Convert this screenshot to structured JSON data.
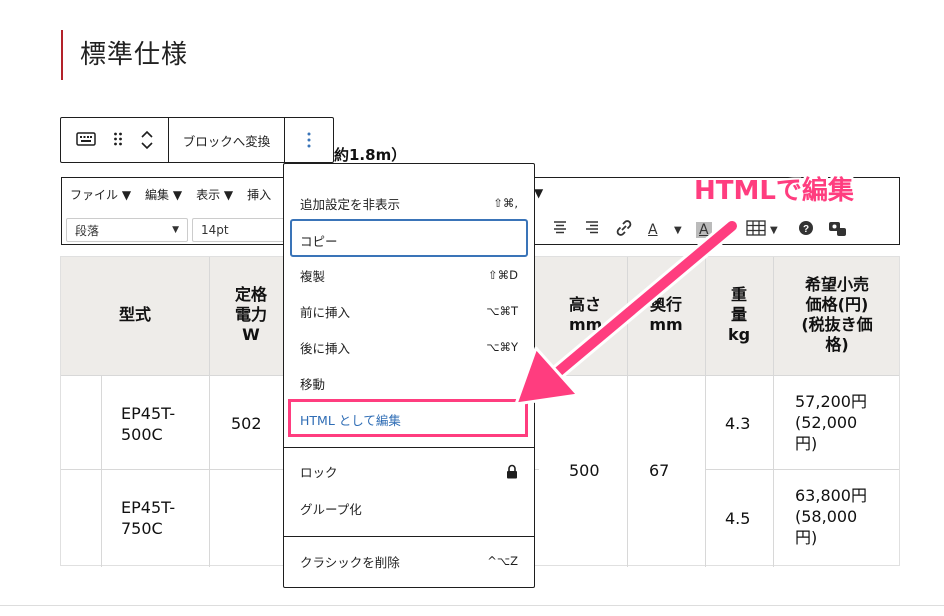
{
  "heading": "標準仕様",
  "block_toolbar": {
    "transform_label": "ブロックへ変換",
    "icons": [
      "keyboard-icon",
      "drag-handle-icon",
      "move-up-icon",
      "move-down-icon",
      "more-options-icon"
    ]
  },
  "subtitle_partial": "約1.8m）",
  "classic_toolbar": {
    "menu": [
      "ファイル ▼",
      "編集 ▼",
      "表示 ▼",
      "挿入"
    ],
    "format_select": "段落",
    "font_size_select": "14pt"
  },
  "table": {
    "headers": {
      "model": "型式",
      "power": [
        "定格",
        "電力",
        "W"
      ],
      "height": [
        "高さ",
        "mm"
      ],
      "depth": [
        "奥行",
        "mm"
      ],
      "weight": [
        "重",
        "量",
        "kg"
      ],
      "price": [
        "希望小売",
        "価格(円)",
        "(税抜き価",
        "格)"
      ]
    },
    "rows": [
      {
        "model": [
          "EP45T-",
          "500C"
        ],
        "power": "502",
        "weight": "4.3",
        "price": [
          "57,200円",
          "(52,000",
          "円)"
        ]
      },
      {
        "model": [
          "EP45T-",
          "750C"
        ],
        "power": "",
        "weight": "4.5",
        "price": [
          "63,800円",
          "(58,000",
          "円)"
        ]
      }
    ],
    "shared": {
      "height": "500",
      "depth": "67"
    }
  },
  "dropdown": {
    "items": [
      {
        "label": "追加設定を非表示",
        "shortcut": "⇧⌘,"
      },
      {
        "label": "コピー",
        "shortcut": ""
      },
      {
        "label": "複製",
        "shortcut": "⇧⌘D"
      },
      {
        "label": "前に挿入",
        "shortcut": "⌥⌘T"
      },
      {
        "label": "後に挿入",
        "shortcut": "⌥⌘Y"
      },
      {
        "label": "移動",
        "shortcut": ""
      },
      {
        "label": "HTML として編集",
        "shortcut": ""
      },
      {
        "label": "ロック",
        "shortcut": ""
      },
      {
        "label": "グループ化",
        "shortcut": ""
      },
      {
        "label": "クラシックを削除",
        "shortcut": "^⌥Z"
      }
    ]
  },
  "annotation": "HTMLで編集",
  "colors": {
    "accent_pink": "#ff3d7f",
    "focus_blue": "#3a74b8",
    "heading_bar": "#b3222a",
    "header_bg": "#eeece9"
  }
}
